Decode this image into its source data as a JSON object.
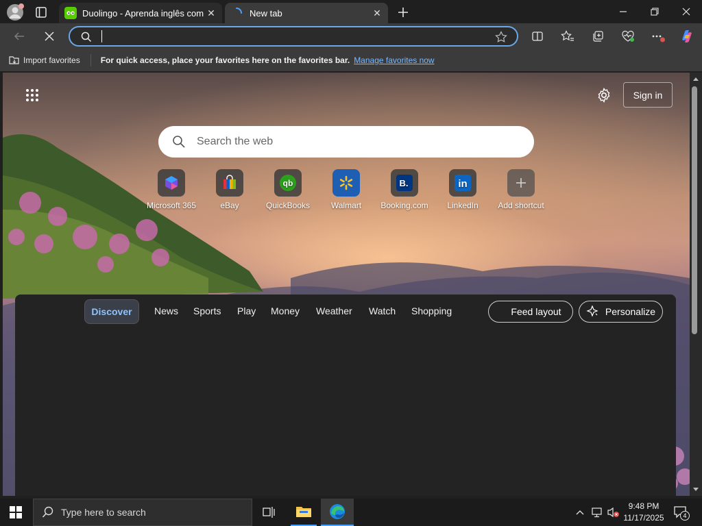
{
  "tabs": [
    {
      "label": "Duolingo - Aprenda inglês com lições",
      "icon": "duolingo-icon",
      "active": false
    },
    {
      "label": "New tab",
      "icon": "loading-spinner-icon",
      "active": true
    }
  ],
  "address_bar": {
    "value": "",
    "placeholder": ""
  },
  "favorites_bar": {
    "import_label": "Import favorites",
    "message": "For quick access, place your favorites here on the favorites bar.",
    "manage_link": "Manage favorites now"
  },
  "newtab": {
    "sign_in": "Sign in",
    "search_placeholder": "Search the web",
    "shortcuts": [
      {
        "label": "Microsoft 365",
        "icon": "microsoft365-icon"
      },
      {
        "label": "eBay",
        "icon": "ebay-icon"
      },
      {
        "label": "QuickBooks",
        "icon": "quickbooks-icon"
      },
      {
        "label": "Walmart",
        "icon": "walmart-icon"
      },
      {
        "label": "Booking.com",
        "icon": "booking-icon"
      },
      {
        "label": "LinkedIn",
        "icon": "linkedin-icon"
      },
      {
        "label": "Add shortcut",
        "icon": "plus-icon"
      }
    ],
    "feed_tabs": [
      "Discover",
      "News",
      "Sports",
      "Play",
      "Money",
      "Weather",
      "Watch",
      "Shopping"
    ],
    "feed_layout": "Feed layout",
    "personalize": "Personalize"
  },
  "taskbar": {
    "search_placeholder": "Type here to search",
    "time": "9:48 PM",
    "date": "11/17/2025",
    "notification_count": "4"
  },
  "colors": {
    "accent": "#6aa8e8",
    "link": "#7ab8ff",
    "active_tab_pill": "#3a3f4a"
  }
}
